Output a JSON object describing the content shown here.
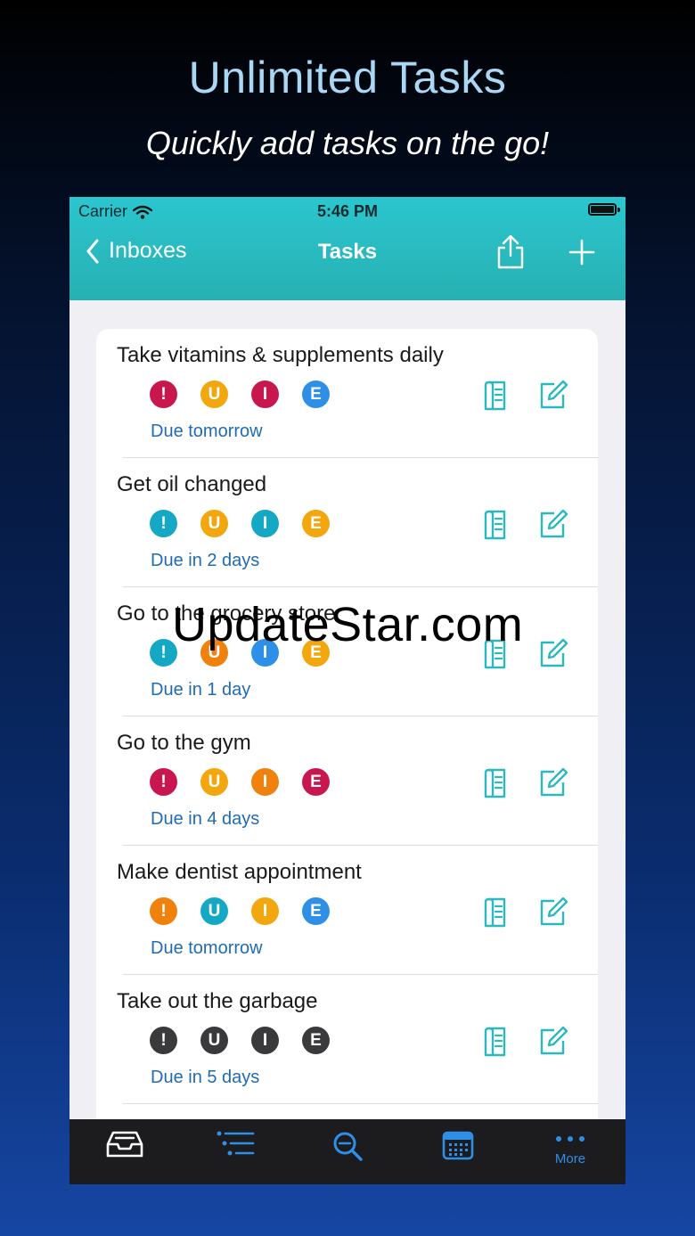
{
  "promo": {
    "headline": "Unlimited Tasks",
    "subline": "Quickly add tasks on the go!"
  },
  "status_bar": {
    "carrier": "Carrier",
    "time": "5:46 PM"
  },
  "nav": {
    "back_label": "Inboxes",
    "title": "Tasks"
  },
  "colors": {
    "red": "#c8174f",
    "yellow": "#f2a70f",
    "teal": "#14a8c4",
    "blue": "#2e8fe6",
    "orange": "#f0810d",
    "dark": "#3a3a3c",
    "accent": "#2bb9bf",
    "due_text": "#1f6bb5"
  },
  "tasks": [
    {
      "title": "Take vitamins & supplements daily",
      "due": "Due tomorrow",
      "badges": [
        {
          "letter": "!",
          "color": "red"
        },
        {
          "letter": "U",
          "color": "yellow"
        },
        {
          "letter": "I",
          "color": "red"
        },
        {
          "letter": "E",
          "color": "blue"
        }
      ]
    },
    {
      "title": "Get oil changed",
      "due": "Due in 2 days",
      "badges": [
        {
          "letter": "!",
          "color": "teal"
        },
        {
          "letter": "U",
          "color": "yellow"
        },
        {
          "letter": "I",
          "color": "teal"
        },
        {
          "letter": "E",
          "color": "yellow"
        }
      ]
    },
    {
      "title": "Go to the grocery store",
      "due": "Due in 1 day",
      "badges": [
        {
          "letter": "!",
          "color": "teal"
        },
        {
          "letter": "U",
          "color": "orange"
        },
        {
          "letter": "I",
          "color": "blue"
        },
        {
          "letter": "E",
          "color": "yellow"
        }
      ]
    },
    {
      "title": "Go to the gym",
      "due": "Due in 4 days",
      "badges": [
        {
          "letter": "!",
          "color": "red"
        },
        {
          "letter": "U",
          "color": "yellow"
        },
        {
          "letter": "I",
          "color": "orange"
        },
        {
          "letter": "E",
          "color": "red"
        }
      ]
    },
    {
      "title": "Make dentist appointment",
      "due": "Due tomorrow",
      "badges": [
        {
          "letter": "!",
          "color": "orange"
        },
        {
          "letter": "U",
          "color": "teal"
        },
        {
          "letter": "I",
          "color": "yellow"
        },
        {
          "letter": "E",
          "color": "blue"
        }
      ]
    },
    {
      "title": "Take out the garbage",
      "due": "Due in 5 days",
      "badges": [
        {
          "letter": "!",
          "color": "dark"
        },
        {
          "letter": "U",
          "color": "dark"
        },
        {
          "letter": "I",
          "color": "dark"
        },
        {
          "letter": "E",
          "color": "dark"
        }
      ]
    }
  ],
  "watermark": "UpdateStar.com",
  "tabbar": {
    "tabs": [
      {
        "icon": "inbox-tray-icon",
        "label": ""
      },
      {
        "icon": "list-icon",
        "label": ""
      },
      {
        "icon": "search-icon",
        "label": ""
      },
      {
        "icon": "calendar-icon",
        "label": ""
      },
      {
        "icon": "more-dots-icon",
        "label": "More"
      }
    ]
  }
}
